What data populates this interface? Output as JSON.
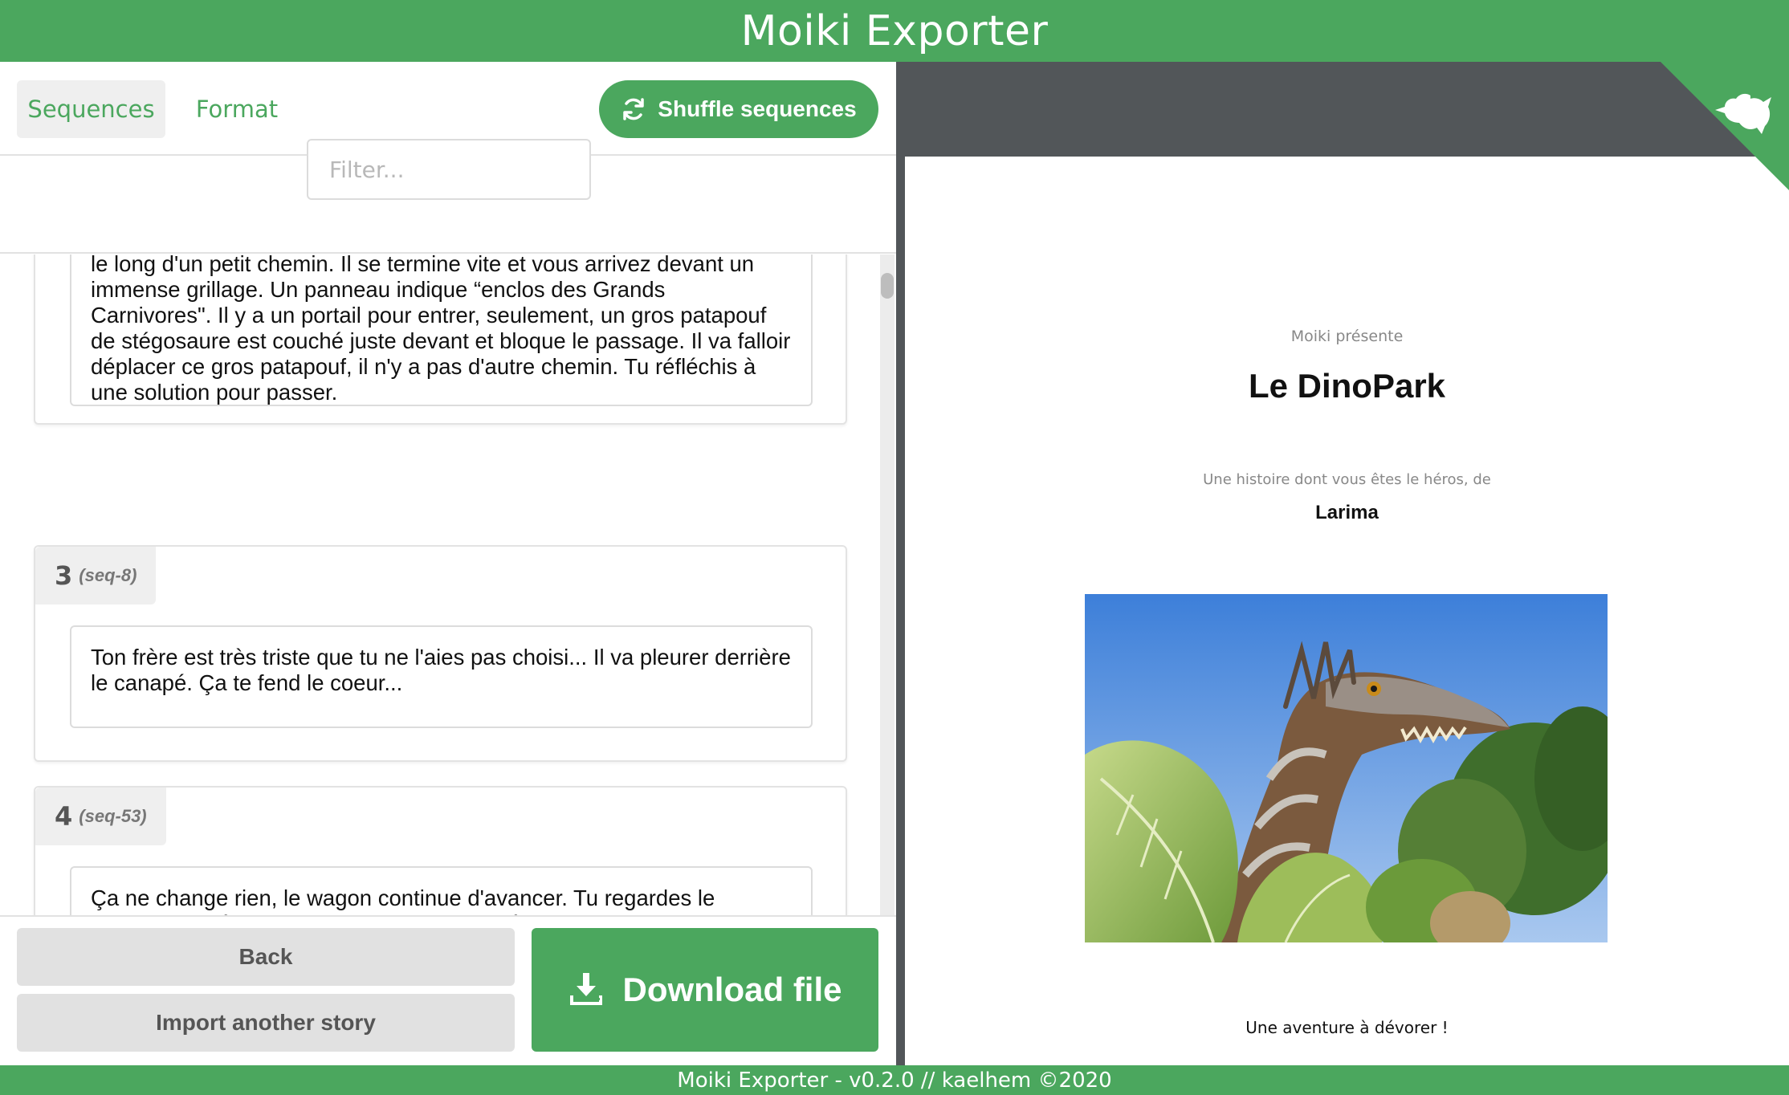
{
  "header": {
    "title": "Moiki Exporter"
  },
  "tabs": {
    "sequences": "Sequences",
    "format": "Format"
  },
  "toolbar": {
    "shuffle_label": "Shuffle sequences"
  },
  "filter": {
    "placeholder": "Filter..."
  },
  "sequences": [
    {
      "text": "le long d'un petit chemin. Il se termine vite et vous arrivez devant un immense grillage. Un panneau indique “enclos des Grands Carnivores\". Il y a un portail pour entrer, seulement, un gros patapouf de stégosaure est couché juste devant et bloque le passage. Il va falloir déplacer ce gros patapouf, il n'y a pas d'autre chemin. Tu réfléchis à une solution pour passer."
    },
    {
      "number": "3",
      "id": "(seq-8)",
      "text": "Ton frère est très triste que tu ne l'aies pas choisi... Il va pleurer derrière le canapé. Ça te fend le coeur..."
    },
    {
      "number": "4",
      "id": "(seq-53)",
      "text": "Ça ne change rien, le wagon continue d'avancer. Tu regardes le diplodocus s'éloigner. Le wagon vous emmène plus profond dans la jungle, vous devez souvent baisser la tête pour éviter les branches et les lianes. Vous voyez passer un groupe de ptérodactyles au-dessus"
    }
  ],
  "actions": {
    "back": "Back",
    "import": "Import another story",
    "download": "Download file"
  },
  "preview": {
    "presents": "Moiki présente",
    "title": "Le DinoPark",
    "subtitle": "Une histoire dont vous êtes le héros, de",
    "author": "Larima",
    "tagline": "Une aventure à dévorer !"
  },
  "footer": {
    "text": "Moiki Exporter - v0.2.0 // kaelhem ©2020"
  },
  "colors": {
    "brand_green": "#4ba75e",
    "viewer_grey": "#525659"
  },
  "icons": {
    "shuffle": "refresh-icon",
    "download": "download-icon",
    "ribbon": "github-cat-icon"
  }
}
